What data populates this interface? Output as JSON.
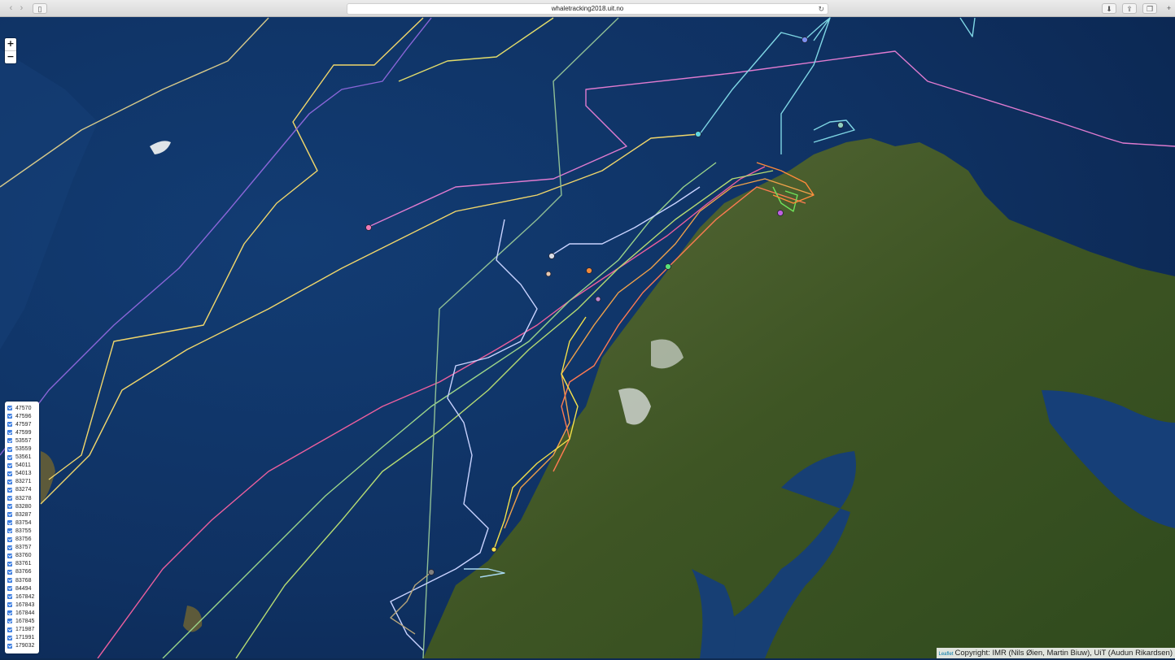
{
  "browser": {
    "url": "whaletracking2018.uit.no",
    "back_icon": "chevron-left-icon",
    "forward_icon": "chevron-right-icon"
  },
  "map": {
    "zoom_in_label": "+",
    "zoom_out_label": "−",
    "attribution_leaflet": "Leaflet",
    "attribution_text": "Copyright: IMR (Nils Øien, Martin Biuw), UiT (Audun Rikardsen)",
    "ocean_color": "#12386b",
    "land_color": "#3f5a24"
  },
  "legend": {
    "items": [
      "47570",
      "47596",
      "47597",
      "47599",
      "53557",
      "53559",
      "53561",
      "54011",
      "54013",
      "83271",
      "83274",
      "83278",
      "83280",
      "83287",
      "83754",
      "83755",
      "83756",
      "83757",
      "83760",
      "83761",
      "83766",
      "83768",
      "84494",
      "167842",
      "167843",
      "167844",
      "167845",
      "171987",
      "171991",
      "179032"
    ]
  }
}
